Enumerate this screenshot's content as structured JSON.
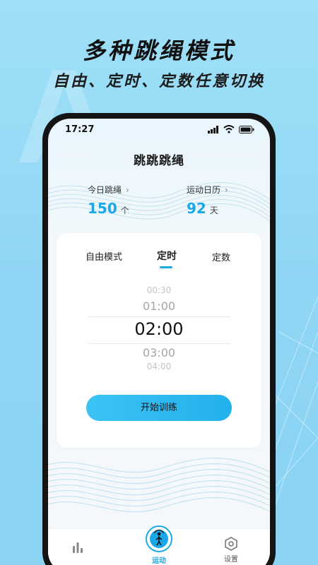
{
  "promo": {
    "title": "多种跳绳模式",
    "subtitle": "自由、定时、定数任意切换"
  },
  "status_bar": {
    "time": "17:27"
  },
  "app": {
    "title": "跳跳跳绳"
  },
  "stats": {
    "today": {
      "label": "今日跳绳",
      "value": "150",
      "unit": "个"
    },
    "calendar": {
      "label": "运动日历",
      "value": "92",
      "unit": "天"
    }
  },
  "mode_tabs": [
    {
      "label": "自由模式",
      "active": false
    },
    {
      "label": "定时",
      "active": true
    },
    {
      "label": "定数",
      "active": false
    }
  ],
  "time_picker": {
    "options": [
      "00:30",
      "01:00",
      "02:00",
      "03:00",
      "04:00"
    ],
    "selected": "02:00"
  },
  "start_button": {
    "label": "开始训练"
  },
  "bottom_nav": [
    {
      "label": "",
      "icon": "bar-chart-icon",
      "active": false
    },
    {
      "label": "运动",
      "icon": "jump-rope-icon",
      "active": true
    },
    {
      "label": "设置",
      "icon": "settings-hex-icon",
      "active": false
    }
  ],
  "colors": {
    "accent": "#1aa8e8",
    "background": "#8fd6f4",
    "phone_frame": "#141414"
  }
}
